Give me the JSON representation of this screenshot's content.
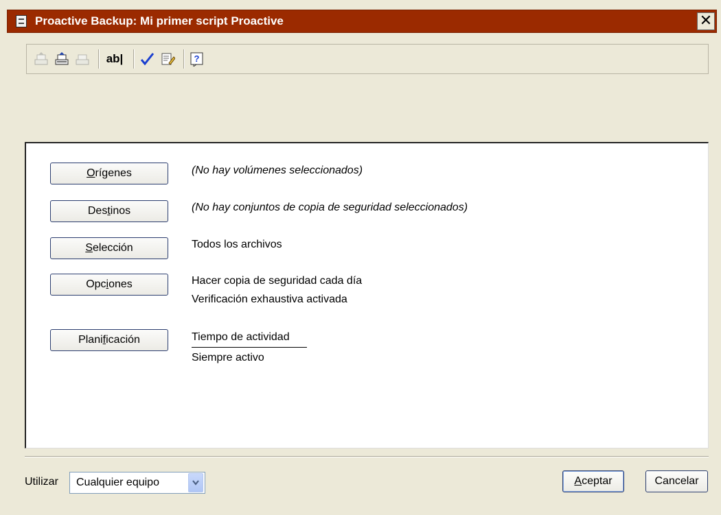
{
  "window": {
    "title": "Proactive Backup: Mi primer script Proactive",
    "close_glyph": "✕",
    "title_icon": "script-document-icon"
  },
  "toolbar": {
    "items": [
      {
        "icon": "tray-eject-icon",
        "state": "disabled"
      },
      {
        "icon": "tray-load-icon",
        "state": "enabled"
      },
      {
        "icon": "tray-icon",
        "state": "disabled"
      },
      {
        "icon": "rename-ab-icon",
        "label": "ab|"
      },
      {
        "icon": "checkmark-icon"
      },
      {
        "icon": "edit-document-icon"
      },
      {
        "icon": "help-icon",
        "label": "?"
      }
    ]
  },
  "rows": {
    "origenes": {
      "label_pre": "",
      "label_u": "O",
      "label_post": "rígenes",
      "desc": "(No hay volúmenes seleccionados)"
    },
    "destinos": {
      "label_pre": "Des",
      "label_u": "t",
      "label_post": "inos",
      "desc": "(No hay conjuntos de copia de seguridad seleccionados)"
    },
    "seleccion": {
      "label_pre": "",
      "label_u": "S",
      "label_post": "elección",
      "desc": "Todos los archivos"
    },
    "opciones": {
      "label_pre": "Opc",
      "label_u": "i",
      "label_post": "ones",
      "desc_line1": "Hacer copia de seguridad cada día",
      "desc_line2": "Verificación exhaustiva activada"
    },
    "planificacion": {
      "label_pre": "Plani",
      "label_u": "f",
      "label_post": "icación",
      "desc_line1": "Tiempo de actividad",
      "desc_line2": "Siempre activo"
    }
  },
  "footer": {
    "utilizar_label": "Utilizar",
    "select_value": "Cualquier equipo",
    "aceptar": {
      "label_u": "A",
      "label_post": "ceptar"
    },
    "cancelar_label": "Cancelar"
  },
  "colors": {
    "titlebar": "#9b2a00",
    "dialog_bg": "#ece9d8"
  }
}
